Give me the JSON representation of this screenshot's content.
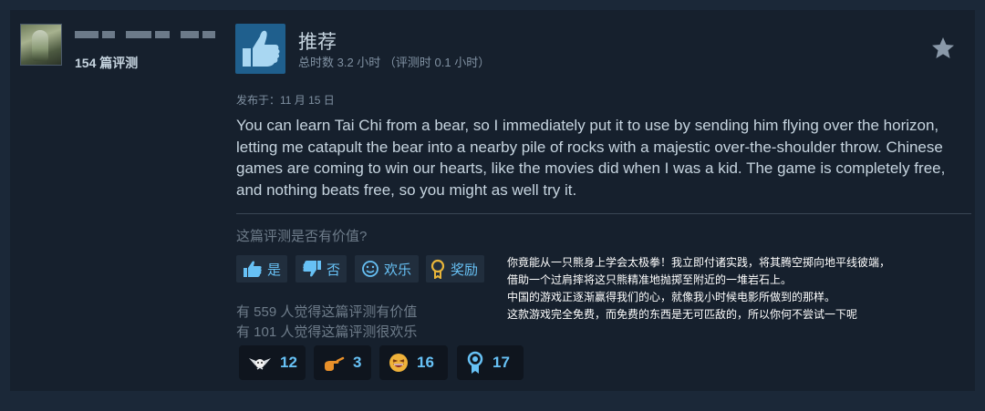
{
  "reviewer": {
    "review_count": "154 篇评测"
  },
  "review": {
    "verdict": "推荐",
    "hours": "总时数 3.2 小时 （评测时 0.1 小时）",
    "posted": "发布于：11 月 15 日",
    "body": "You can learn Tai Chi from a bear, so I immediately put it to use by sending him flying over the horizon, letting me catapult the bear into a nearby pile of rocks with a majestic over-the-shoulder throw. Chinese games are coming to win our hearts, like the movies did when I was a kid. The game is completely free, and nothing beats free, so you might as well try it."
  },
  "feedback": {
    "question": "这篇评测是否有价值?",
    "yes_label": "是",
    "no_label": "否",
    "funny_label": "欢乐",
    "award_label": "奖励",
    "helpful_stat": "有 559 人觉得这篇评测有价值",
    "funny_stat": "有 101 人觉得这篇评测很欢乐"
  },
  "translation": {
    "lines": [
      "你竟能从一只熊身上学会太极拳！我立即付诸实践，将其腾空掷向地平线彼端，",
      "借助一个过肩摔将这只熊精准地抛掷至附近的一堆岩石上。",
      "中国的游戏正逐渐赢得我们的心，就像我小时候电影所做到的那样。",
      "这款游戏完全免费，而免费的东西是无可匹敌的，所以你何不尝试一下呢"
    ]
  },
  "awards": [
    {
      "icon": "winged-award-icon",
      "count": "12"
    },
    {
      "icon": "pointing-hand-icon",
      "count": "3"
    },
    {
      "icon": "laughing-face-icon",
      "count": "16"
    },
    {
      "icon": "medal-icon",
      "count": "17"
    }
  ],
  "colors": {
    "background": "#1b2838",
    "card": "#16202d",
    "accent": "#67c1f5",
    "thumb_box": "#1f5f8d"
  }
}
